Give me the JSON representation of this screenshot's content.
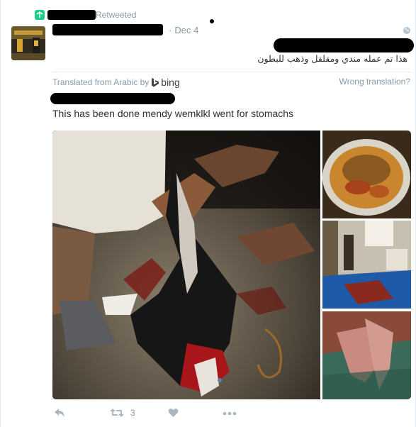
{
  "retweet": {
    "label": "Retweeted"
  },
  "tweet": {
    "date": "Dec 4",
    "text_arabic": "هذا تم عمله مندي ومقلقل وذهب للبطون",
    "translation_credit": "Translated from Arabic by",
    "translation_provider": "bing",
    "wrong_translation": "Wrong translation?",
    "translated_text": "This has been done mendy wemklkl went for  stomachs"
  },
  "actions": {
    "retweet_count": "3",
    "icons": [
      "reply-icon",
      "retweet-icon",
      "like-icon",
      "more-icon"
    ]
  },
  "colors": {
    "retweet_green": "#19cf86",
    "meta_gray": "#8899a6",
    "text": "#292f33"
  }
}
